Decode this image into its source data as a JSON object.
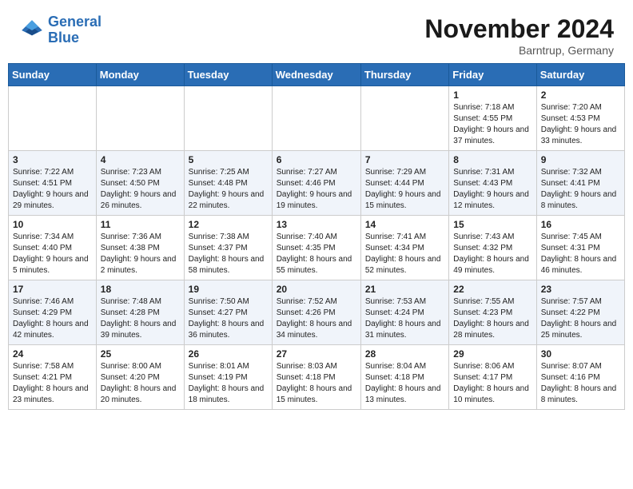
{
  "header": {
    "logo_line1": "General",
    "logo_line2": "Blue",
    "month": "November 2024",
    "location": "Barntrup, Germany"
  },
  "days_of_week": [
    "Sunday",
    "Monday",
    "Tuesday",
    "Wednesday",
    "Thursday",
    "Friday",
    "Saturday"
  ],
  "weeks": [
    [
      {
        "day": "",
        "info": ""
      },
      {
        "day": "",
        "info": ""
      },
      {
        "day": "",
        "info": ""
      },
      {
        "day": "",
        "info": ""
      },
      {
        "day": "",
        "info": ""
      },
      {
        "day": "1",
        "info": "Sunrise: 7:18 AM\nSunset: 4:55 PM\nDaylight: 9 hours and 37 minutes."
      },
      {
        "day": "2",
        "info": "Sunrise: 7:20 AM\nSunset: 4:53 PM\nDaylight: 9 hours and 33 minutes."
      }
    ],
    [
      {
        "day": "3",
        "info": "Sunrise: 7:22 AM\nSunset: 4:51 PM\nDaylight: 9 hours and 29 minutes."
      },
      {
        "day": "4",
        "info": "Sunrise: 7:23 AM\nSunset: 4:50 PM\nDaylight: 9 hours and 26 minutes."
      },
      {
        "day": "5",
        "info": "Sunrise: 7:25 AM\nSunset: 4:48 PM\nDaylight: 9 hours and 22 minutes."
      },
      {
        "day": "6",
        "info": "Sunrise: 7:27 AM\nSunset: 4:46 PM\nDaylight: 9 hours and 19 minutes."
      },
      {
        "day": "7",
        "info": "Sunrise: 7:29 AM\nSunset: 4:44 PM\nDaylight: 9 hours and 15 minutes."
      },
      {
        "day": "8",
        "info": "Sunrise: 7:31 AM\nSunset: 4:43 PM\nDaylight: 9 hours and 12 minutes."
      },
      {
        "day": "9",
        "info": "Sunrise: 7:32 AM\nSunset: 4:41 PM\nDaylight: 9 hours and 8 minutes."
      }
    ],
    [
      {
        "day": "10",
        "info": "Sunrise: 7:34 AM\nSunset: 4:40 PM\nDaylight: 9 hours and 5 minutes."
      },
      {
        "day": "11",
        "info": "Sunrise: 7:36 AM\nSunset: 4:38 PM\nDaylight: 9 hours and 2 minutes."
      },
      {
        "day": "12",
        "info": "Sunrise: 7:38 AM\nSunset: 4:37 PM\nDaylight: 8 hours and 58 minutes."
      },
      {
        "day": "13",
        "info": "Sunrise: 7:40 AM\nSunset: 4:35 PM\nDaylight: 8 hours and 55 minutes."
      },
      {
        "day": "14",
        "info": "Sunrise: 7:41 AM\nSunset: 4:34 PM\nDaylight: 8 hours and 52 minutes."
      },
      {
        "day": "15",
        "info": "Sunrise: 7:43 AM\nSunset: 4:32 PM\nDaylight: 8 hours and 49 minutes."
      },
      {
        "day": "16",
        "info": "Sunrise: 7:45 AM\nSunset: 4:31 PM\nDaylight: 8 hours and 46 minutes."
      }
    ],
    [
      {
        "day": "17",
        "info": "Sunrise: 7:46 AM\nSunset: 4:29 PM\nDaylight: 8 hours and 42 minutes."
      },
      {
        "day": "18",
        "info": "Sunrise: 7:48 AM\nSunset: 4:28 PM\nDaylight: 8 hours and 39 minutes."
      },
      {
        "day": "19",
        "info": "Sunrise: 7:50 AM\nSunset: 4:27 PM\nDaylight: 8 hours and 36 minutes."
      },
      {
        "day": "20",
        "info": "Sunrise: 7:52 AM\nSunset: 4:26 PM\nDaylight: 8 hours and 34 minutes."
      },
      {
        "day": "21",
        "info": "Sunrise: 7:53 AM\nSunset: 4:24 PM\nDaylight: 8 hours and 31 minutes."
      },
      {
        "day": "22",
        "info": "Sunrise: 7:55 AM\nSunset: 4:23 PM\nDaylight: 8 hours and 28 minutes."
      },
      {
        "day": "23",
        "info": "Sunrise: 7:57 AM\nSunset: 4:22 PM\nDaylight: 8 hours and 25 minutes."
      }
    ],
    [
      {
        "day": "24",
        "info": "Sunrise: 7:58 AM\nSunset: 4:21 PM\nDaylight: 8 hours and 23 minutes."
      },
      {
        "day": "25",
        "info": "Sunrise: 8:00 AM\nSunset: 4:20 PM\nDaylight: 8 hours and 20 minutes."
      },
      {
        "day": "26",
        "info": "Sunrise: 8:01 AM\nSunset: 4:19 PM\nDaylight: 8 hours and 18 minutes."
      },
      {
        "day": "27",
        "info": "Sunrise: 8:03 AM\nSunset: 4:18 PM\nDaylight: 8 hours and 15 minutes."
      },
      {
        "day": "28",
        "info": "Sunrise: 8:04 AM\nSunset: 4:18 PM\nDaylight: 8 hours and 13 minutes."
      },
      {
        "day": "29",
        "info": "Sunrise: 8:06 AM\nSunset: 4:17 PM\nDaylight: 8 hours and 10 minutes."
      },
      {
        "day": "30",
        "info": "Sunrise: 8:07 AM\nSunset: 4:16 PM\nDaylight: 8 hours and 8 minutes."
      }
    ]
  ]
}
